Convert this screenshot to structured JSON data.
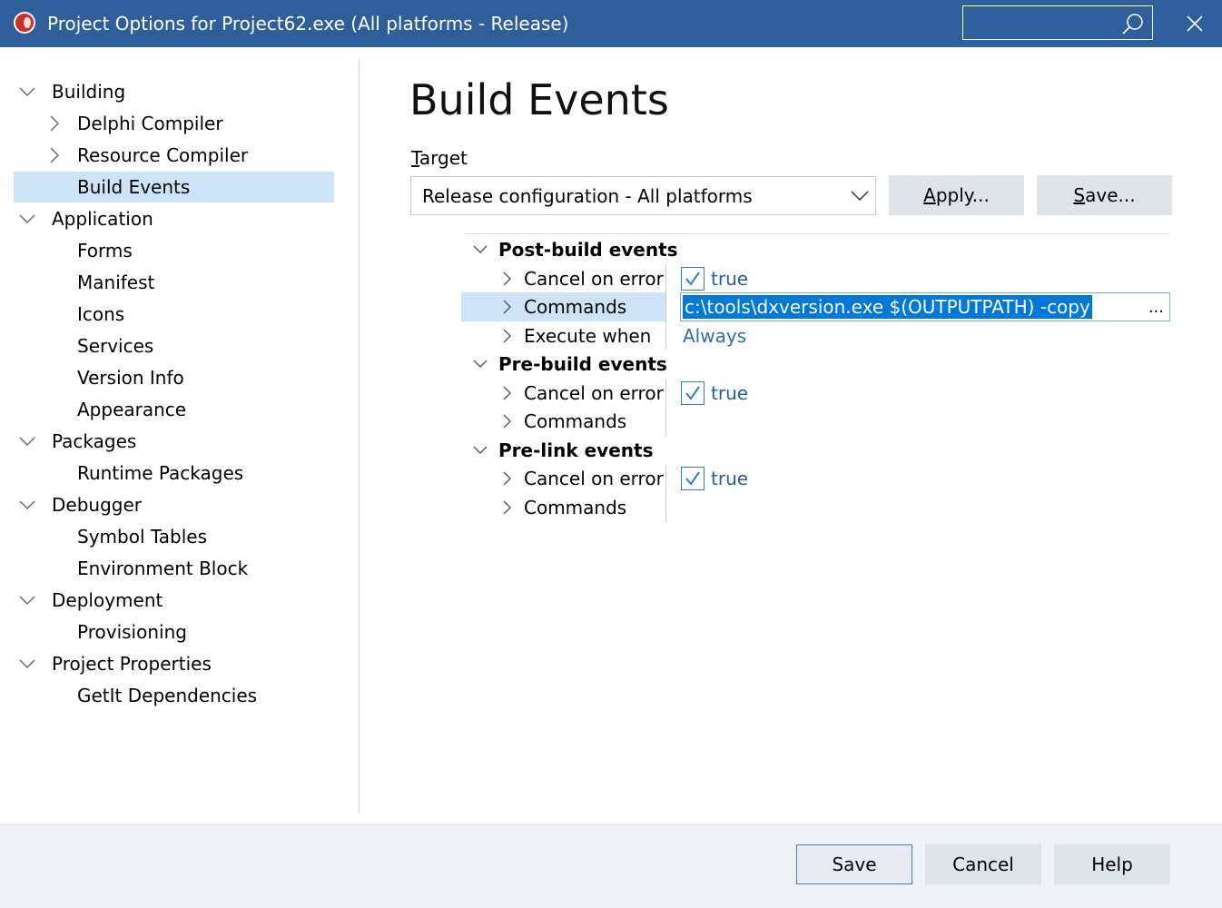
{
  "window": {
    "title": "Project Options for Project62.exe  (All platforms - Release)",
    "search_value": ""
  },
  "sidebar": {
    "items": [
      {
        "label": "Building",
        "expander": "collapse"
      },
      {
        "label": "Delphi Compiler",
        "expander": "expand"
      },
      {
        "label": "Resource Compiler",
        "expander": "expand"
      },
      {
        "label": "Build Events",
        "expander": "none",
        "selected": true
      },
      {
        "label": "Application",
        "expander": "collapse"
      },
      {
        "label": "Forms",
        "expander": "none"
      },
      {
        "label": "Manifest",
        "expander": "none"
      },
      {
        "label": "Icons",
        "expander": "none"
      },
      {
        "label": "Services",
        "expander": "none"
      },
      {
        "label": "Version Info",
        "expander": "none"
      },
      {
        "label": "Appearance",
        "expander": "none"
      },
      {
        "label": "Packages",
        "expander": "collapse"
      },
      {
        "label": "Runtime Packages",
        "expander": "none"
      },
      {
        "label": "Debugger",
        "expander": "collapse"
      },
      {
        "label": "Symbol Tables",
        "expander": "none"
      },
      {
        "label": "Environment Block",
        "expander": "none"
      },
      {
        "label": "Deployment",
        "expander": "collapse"
      },
      {
        "label": "Provisioning",
        "expander": "none"
      },
      {
        "label": "Project Properties",
        "expander": "collapse"
      },
      {
        "label": "GetIt Dependencies",
        "expander": "none"
      }
    ]
  },
  "main": {
    "title": "Build Events",
    "target_label_first": "T",
    "target_label_rest": "arget",
    "target_value": "Release configuration - All platforms",
    "apply_label_first": "A",
    "apply_label_rest": "pply...",
    "save_label_first": "S",
    "save_label_rest": "ave..."
  },
  "grid": {
    "post_build": {
      "label": "Post-build events",
      "cancel_label": "Cancel on error",
      "cancel_value": "true",
      "commands_label": "Commands",
      "commands_value": "c:\\tools\\dxversion.exe $(OUTPUTPATH) -copy",
      "commands_ellipsis": "...",
      "execute_label": "Execute when",
      "execute_value": "Always"
    },
    "pre_build": {
      "label": "Pre-build events",
      "cancel_label": "Cancel on error",
      "cancel_value": "true",
      "commands_label": "Commands"
    },
    "pre_link": {
      "label": "Pre-link events",
      "cancel_label": "Cancel on error",
      "cancel_value": "true",
      "commands_label": "Commands"
    }
  },
  "footer": {
    "save": "Save",
    "cancel": "Cancel",
    "help": "Help"
  },
  "colors": {
    "titlebar": "#2e5f9c",
    "selection": "#cde3f7",
    "accent": "#0078d7"
  },
  "icons": [
    "app-icon",
    "search-icon",
    "close-icon",
    "chevron-down-icon",
    "chevron-right-icon",
    "checkmark-icon"
  ]
}
